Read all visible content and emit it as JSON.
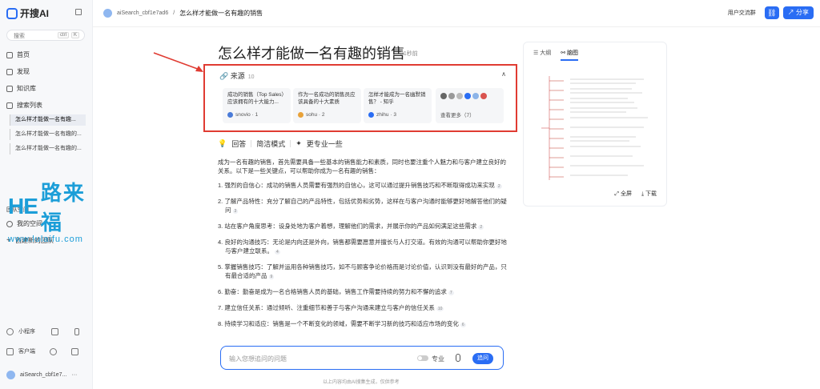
{
  "app": {
    "name": "开搜AI"
  },
  "sidebar": {
    "search_placeholder": "搜索",
    "kbd_ctrl": "ctrl",
    "kbd_k": "K",
    "nav": [
      {
        "label": "首页",
        "icon": "home-icon"
      },
      {
        "label": "发现",
        "icon": "compass-icon"
      },
      {
        "label": "知识库",
        "icon": "book-icon"
      },
      {
        "label": "搜索列表",
        "icon": "list-icon"
      }
    ],
    "history": [
      "怎么样才能做一名有趣...",
      "怎么样才能做一名有趣的...",
      "怎么样才能做一名有趣的..."
    ],
    "team_header": "团队空间",
    "my_space": "我的空间",
    "create_team": "创建新的团队",
    "mini_program": "小程序",
    "customer_service": "客户端",
    "user_name": "aiSearch_cbf1e7..."
  },
  "watermark": {
    "logo_letters": "HE",
    "cn": "路来福",
    "url": "www.lulaifu.com"
  },
  "topbar": {
    "session_name": "aiSearch_cbf1e7ad6",
    "separator": "/",
    "page_title": "怎么样才能做一名有趣的销售",
    "community_label": "用户交流群",
    "share_label": "分享"
  },
  "question": {
    "title": "怎么样才能做一名有趣的销售",
    "elapsed": "21秒前"
  },
  "sources": {
    "label": "来源",
    "count": "10",
    "cards": [
      {
        "title": "成功的销售（Top Sales）应该拥有的十大能力...",
        "site": "snovio · 1",
        "color": "#4a7bd8"
      },
      {
        "title": "作为一名成功的销售员应该具备的十大素质",
        "site": "sohu · 2",
        "color": "#e8a23a"
      },
      {
        "title": "怎样才能成为一名幽默销售？ - 知乎",
        "site": "zhihu · 3",
        "color": "#2a6df4"
      }
    ],
    "more_label": "查看更多（7）"
  },
  "modes": {
    "answer": "回答",
    "concise": "简洁模式",
    "pro": "更专业一些"
  },
  "answer": {
    "intro": "成为一名有趣的销售，首先需要具备一些基本的销售能力和素质，同时也要注重个人魅力和与客户建立良好的关系。以下是一些关键点，可以帮助你成为一名有趣的销售：",
    "items": [
      {
        "text": "1. 强烈的自信心：成功的销售人员需要有强烈的自信心，这可以通过提升销售技巧和不断取得成功来实现",
        "cite": "2"
      },
      {
        "text": "2. 了解产品特性：充分了解自己的产品特性，包括优势和劣势，这样在与客户沟通时能够更好地解答他们的疑问",
        "cite": "3"
      },
      {
        "text": "3. 站在客户角度思考：设身处地为客户着想，理解他们的需求，并展示你的产品如何满足这些需求",
        "cite": "2"
      },
      {
        "text": "4. 良好的沟通技巧：无论是内向还是外向，销售都需要愿意并擅长与人打交道。有效的沟通可以帮助你更好地与客户建立联系。",
        "cite": "4"
      },
      {
        "text": "5. 掌握销售技巧：了解并运用各种销售技巧，如不与顾客争论价格而是讨论价值，认识到没有最好的产品，只有最合适的产品",
        "cite": "9"
      },
      {
        "text": "6. 勤奋：勤奋是成为一名合格销售人员的基础，销售工作需要持续的努力和不懈的追求",
        "cite": "7"
      },
      {
        "text": "7. 建立信任关系：通过倾听、注重细节和善于与客户沟通来建立与客户的信任关系",
        "cite": "10"
      },
      {
        "text": "8. 持续学习和适应：销售是一个不断变化的领域，需要不断学习新的技巧和适应市场的变化",
        "cite": "6"
      }
    ]
  },
  "input": {
    "placeholder": "输入您想追问的问题",
    "pro_label": "专业",
    "send_label": "追问"
  },
  "footer": {
    "disclaimer": "以上内容均由AI搜集生成，仅供参考"
  },
  "panel": {
    "tab_outline": "大纲",
    "tab_mindmap": "脑图",
    "fullscreen": "全屏",
    "download": "下载"
  },
  "colors": {
    "accent": "#2a6df4",
    "highlight_border": "#e03b32",
    "watermark": "#1c9ed8"
  }
}
